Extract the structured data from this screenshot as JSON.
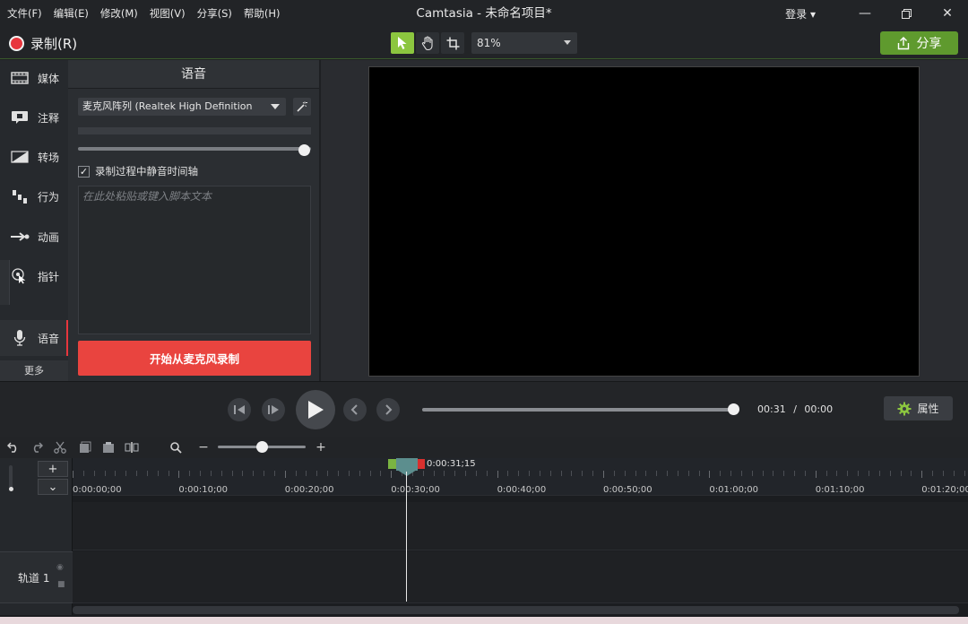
{
  "menu": [
    "文件(F)",
    "编辑(E)",
    "修改(M)",
    "视图(V)",
    "分享(S)",
    "帮助(H)"
  ],
  "window": {
    "title": "Camtasia - 未命名项目*",
    "login": "登录 ▾"
  },
  "toolbar": {
    "record_label": "录制(R)",
    "zoom": "81%",
    "share_label": "分享"
  },
  "sidebar": {
    "items": [
      {
        "label": "媒体",
        "icon": "film-icon"
      },
      {
        "label": "注释",
        "icon": "annotation-icon"
      },
      {
        "label": "转场",
        "icon": "transition-icon"
      },
      {
        "label": "行为",
        "icon": "behavior-icon"
      },
      {
        "label": "动画",
        "icon": "animation-icon"
      },
      {
        "label": "指针",
        "icon": "cursor-icon"
      },
      {
        "label": "语音",
        "icon": "microphone-icon",
        "active": true
      }
    ],
    "more": "更多"
  },
  "panel": {
    "title": "语音",
    "mic_device": "麦克风阵列 (Realtek High Definition",
    "mute_label": "录制过程中静音时间轴",
    "mute_checked": true,
    "script_placeholder": "在此处粘贴或键入脚本文本",
    "volume_fraction": 1.0,
    "record_button": "开始从麦克风录制"
  },
  "playback": {
    "current_time": "00:31",
    "separator": "/",
    "total_time": "00:00",
    "properties_label": "属性",
    "progress_fraction": 1.0
  },
  "timeline": {
    "playhead_time": "0:00:31;15",
    "ruler_labels": [
      "0:00:00;00",
      "0:00:10;00",
      "0:00:20;00",
      "0:00:30;00",
      "0:00:40;00",
      "0:00:50;00",
      "0:01:00;00",
      "0:01:10;00",
      "0:01:20;00"
    ],
    "track_name": "轨道 1",
    "add_track": "+",
    "collapse": "⌄",
    "zoom_minus": "−",
    "zoom_plus": "+"
  },
  "colors": {
    "accent": "#8cc63f",
    "record": "#e9443f",
    "share": "#5f9a2e"
  }
}
